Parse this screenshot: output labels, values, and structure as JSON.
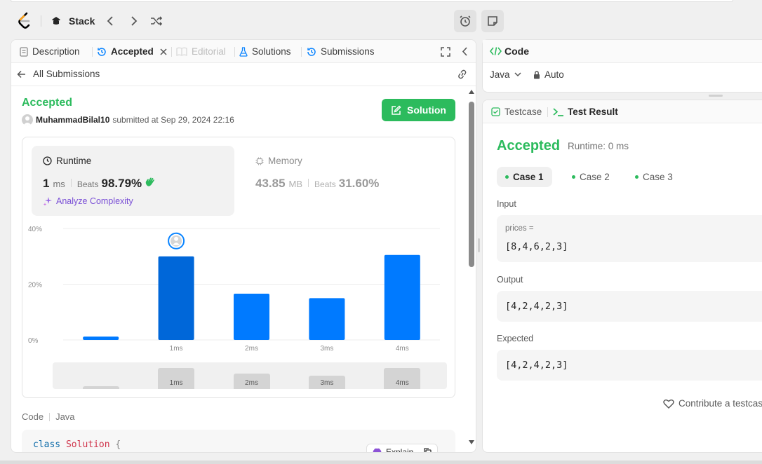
{
  "header": {
    "problem_list_title": "Stack"
  },
  "left_tabs": [
    {
      "label": "Description"
    },
    {
      "label": "Accepted"
    },
    {
      "label": "Editorial"
    },
    {
      "label": "Solutions"
    },
    {
      "label": "Submissions"
    }
  ],
  "submission": {
    "back_label": "All Submissions",
    "status": "Accepted",
    "username": "MuhammadBilal10",
    "submitted_text": "submitted at Sep 29, 2024 22:16",
    "solution_button": "Solution"
  },
  "runtime": {
    "label": "Runtime",
    "value": "1",
    "unit": "ms",
    "beats_label": "Beats",
    "beats_value": "98.79%",
    "analyze_label": "Analyze Complexity"
  },
  "memory": {
    "label": "Memory",
    "value": "43.85",
    "unit": "MB",
    "beats_label": "Beats",
    "beats_value": "31.60%"
  },
  "chart_data": {
    "type": "bar",
    "categories": [
      "",
      "1ms",
      "2ms",
      "3ms",
      "4ms"
    ],
    "values": [
      1.2,
      30,
      16.6,
      15,
      30.5
    ],
    "highlight_index": 1,
    "ytick_labels": [
      "0%",
      "20%",
      "40%"
    ],
    "ylim": [
      0,
      40
    ],
    "grid": true,
    "colors": {
      "bar": "#007aff",
      "highlight": "#0067d9"
    },
    "mini_labels": [
      "",
      "1ms",
      "2ms",
      "3ms",
      "4ms"
    ]
  },
  "code_section": {
    "label": "Code",
    "language": "Java",
    "first_line_keyword": "class",
    "first_line_name": "Solution",
    "first_line_brace": "{",
    "explain_label": "Explain"
  },
  "code_panel": {
    "title": "Code",
    "language": "Java",
    "auto_label": "Auto"
  },
  "result_panel": {
    "testcase_tab": "Testcase",
    "result_tab": "Test Result",
    "status": "Accepted",
    "runtime_text": "Runtime: 0 ms",
    "cases": [
      {
        "label": "Case 1"
      },
      {
        "label": "Case 2"
      },
      {
        "label": "Case 3"
      }
    ],
    "input_label": "Input",
    "input_var": "prices =",
    "input_value": "[8,4,6,2,3]",
    "output_label": "Output",
    "output_value": "[4,2,4,2,3]",
    "expected_label": "Expected",
    "expected_value": "[4,2,4,2,3]",
    "contribute_label": "Contribute a testcas"
  }
}
